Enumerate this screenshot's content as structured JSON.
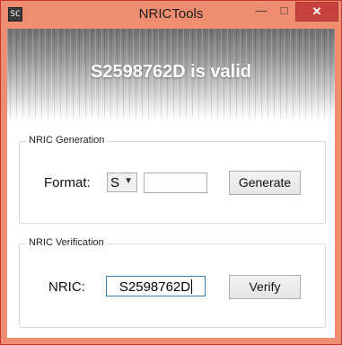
{
  "window": {
    "title": "NRICTools",
    "icon_glyph": "SC",
    "close_glyph": "✕",
    "minimize_glyph": "—",
    "maximize_glyph": "□"
  },
  "colors": {
    "titlebar": "#ee8d70",
    "close": "#c7423f"
  },
  "banner": {
    "status_text": "S2598762D is valid"
  },
  "generation": {
    "legend": "NRIC Generation",
    "format_label": "Format:",
    "format_selected": "S",
    "format_input_value": "",
    "generate_label": "Generate"
  },
  "verification": {
    "legend": "NRIC Verification",
    "nric_label": "NRIC:",
    "nric_value": "S2598762D",
    "verify_label": "Verify"
  }
}
